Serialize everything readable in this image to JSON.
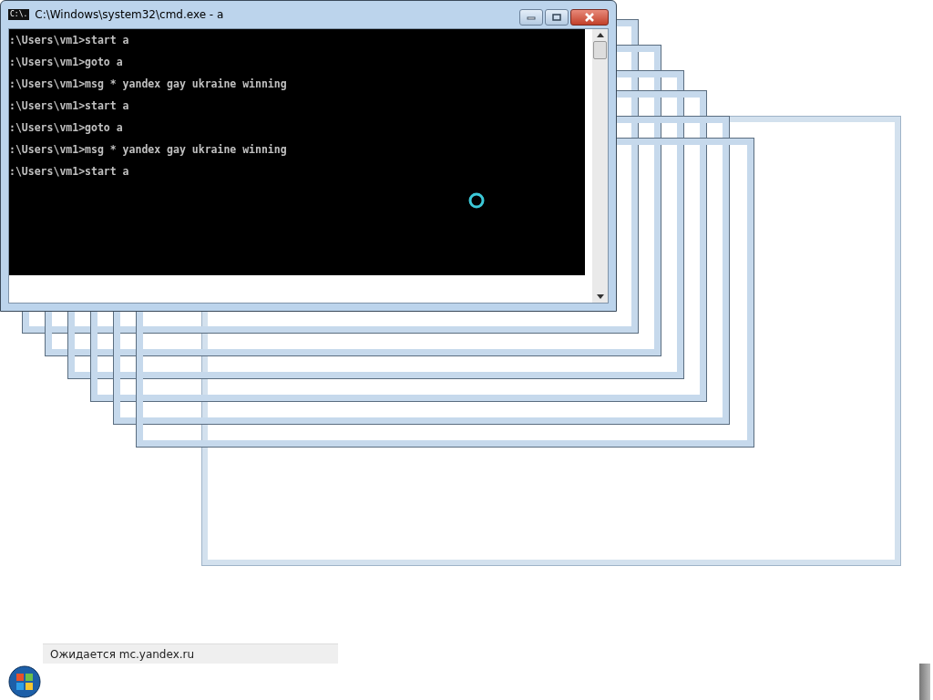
{
  "window": {
    "title": "C:\\Windows\\system32\\cmd.exe - a",
    "icon_text": "C:\\."
  },
  "console_lines": [
    ":\\Users\\vm1>start a",
    ":\\Users\\vm1>goto a",
    ":\\Users\\vm1>msg * yandex gay ukraine winning",
    ":\\Users\\vm1>start a",
    ":\\Users\\vm1>goto a",
    ":\\Users\\vm1>msg * yandex gay ukraine winning",
    ":\\Users\\vm1>start a"
  ],
  "status_bar": {
    "text": "Ожидается mc.yandex.ru"
  }
}
